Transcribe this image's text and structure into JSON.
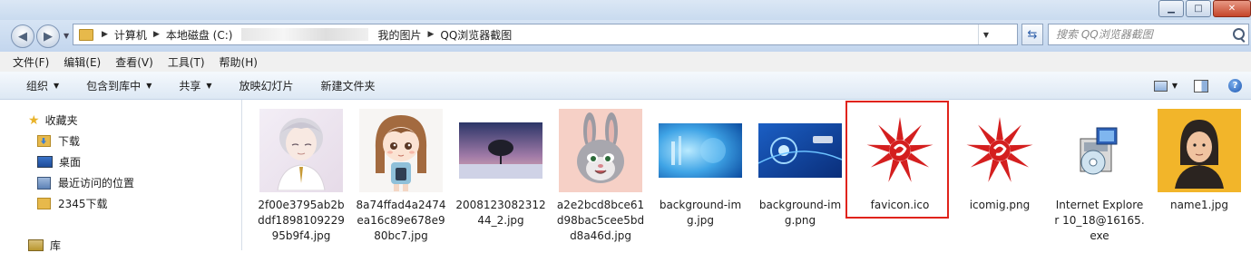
{
  "window": {
    "buttons": {
      "minimize": "▁",
      "maximize": "□",
      "close": "✕"
    }
  },
  "address": {
    "crumbs": [
      "计算机",
      "本地磁盘 (C:)",
      "我的图片",
      "QQ浏览器截图"
    ],
    "dropdown": "▼",
    "refresh": "⇆"
  },
  "search": {
    "placeholder": "搜索 QQ浏览器截图"
  },
  "menu": [
    "文件(F)",
    "编辑(E)",
    "查看(V)",
    "工具(T)",
    "帮助(H)"
  ],
  "toolbar": {
    "items": [
      "组织",
      "包含到库中",
      "共享",
      "放映幻灯片",
      "新建文件夹"
    ],
    "help": "?"
  },
  "nav": {
    "favorites": "收藏夹",
    "items": [
      "下载",
      "桌面",
      "最近访问的位置",
      "2345下载"
    ],
    "libraries": "库"
  },
  "files": [
    {
      "name": "2f00e3795ab2bddf189810922995b9f4.jpg",
      "icon": "anime-boy-thumbnail"
    },
    {
      "name": "8a74ffad4a2474ea16c89e678e980bc7.jpg",
      "icon": "chibi-girl-thumbnail"
    },
    {
      "name": "2008123082312 44_2.jpg",
      "icon": "winter-tree-thumbnail"
    },
    {
      "name": "a2e2bcd8bce61d98bac5cee5bdd8a46d.jpg",
      "icon": "bunny-thumbnail"
    },
    {
      "name": "background-img.jpg",
      "icon": "blue-background-thumbnail"
    },
    {
      "name": "background-img.png",
      "icon": "blue-eye-thumbnail"
    },
    {
      "name": "favicon.ico",
      "icon": "red-sun-logo"
    },
    {
      "name": "icomig.png",
      "icon": "red-sun-logo"
    },
    {
      "name": "Internet Explorer 10_18@16165.exe",
      "icon": "installer-icon"
    },
    {
      "name": "name1.jpg",
      "icon": "avatar-thumbnail"
    }
  ],
  "colors": {
    "selection": "#e0231b",
    "logo": "#d41f1f"
  }
}
